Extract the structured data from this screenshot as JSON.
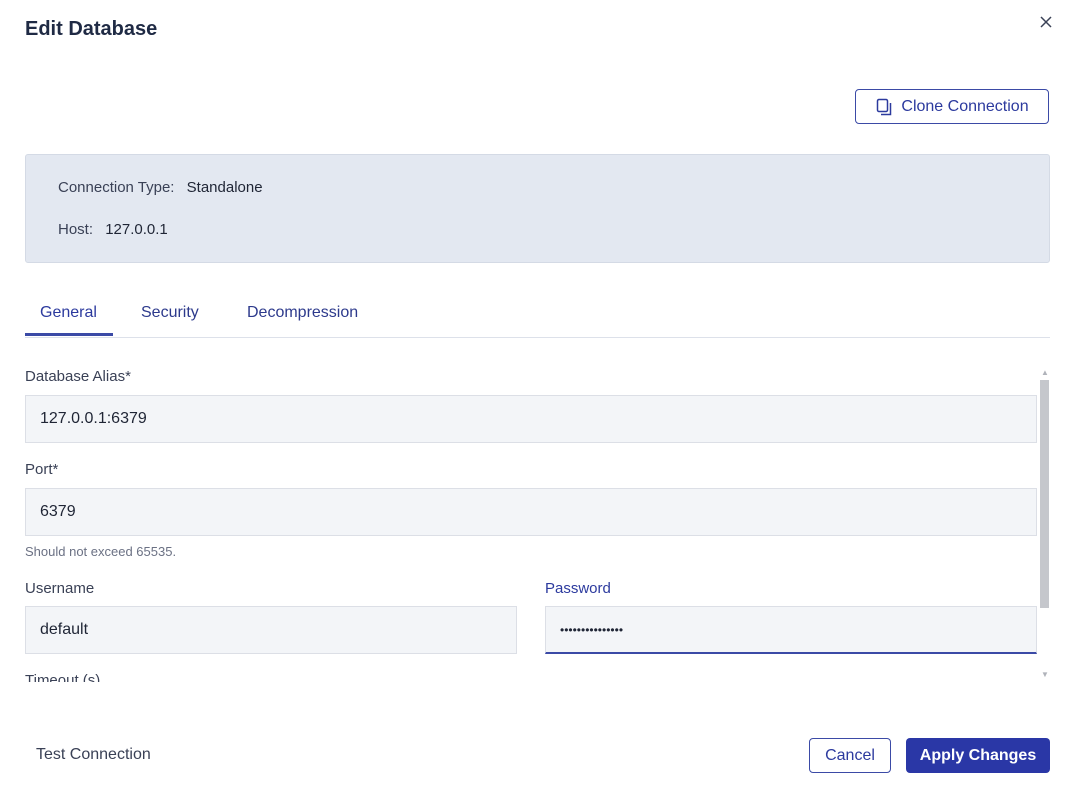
{
  "dialog": {
    "title": "Edit Database"
  },
  "clone": {
    "label": "Clone Connection"
  },
  "info": {
    "connection_type_label": "Connection Type:",
    "connection_type_value": "Standalone",
    "host_label": "Host:",
    "host_value": "127.0.0.1"
  },
  "tabs": [
    {
      "label": "General",
      "active": true
    },
    {
      "label": "Security",
      "active": false
    },
    {
      "label": "Decompression",
      "active": false
    }
  ],
  "fields": {
    "alias": {
      "label": "Database Alias*",
      "value": "127.0.0.1:6379"
    },
    "port": {
      "label": "Port*",
      "value": "6379",
      "hint": "Should not exceed 65535."
    },
    "username": {
      "label": "Username",
      "value": "default"
    },
    "password": {
      "label": "Password",
      "value": "•••••••••••••••"
    },
    "timeout": {
      "label": "Timeout (s)"
    }
  },
  "footer": {
    "test_connection": "Test Connection",
    "cancel": "Cancel",
    "apply": "Apply Changes"
  },
  "colors": {
    "accent": "#2a37a6",
    "info_bg": "#e3e8f1",
    "input_bg": "#f3f5f8"
  }
}
